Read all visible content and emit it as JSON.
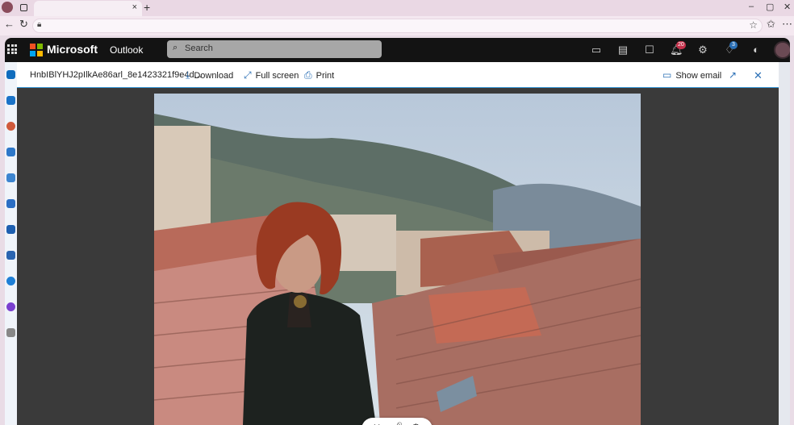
{
  "browser": {
    "close_tab_glyph": "×",
    "new_tab_glyph": "+",
    "window_controls": [
      "–",
      "▢",
      "✕"
    ],
    "nav": [
      "←",
      "↻"
    ],
    "toolbar_right": [
      "☆",
      "✩",
      "⋯"
    ]
  },
  "outlook": {
    "brand": "Microsoft",
    "app": "Outlook",
    "search_placeholder": "Search",
    "notifications_badge": "20",
    "tips_badge": "3",
    "colors": {
      "topbar": "#131313",
      "accent": "#2a6fb5",
      "badge": "#c4314b"
    }
  },
  "viewer": {
    "filename": "HnbIBlYHJ2pIlkAe86arl_8e1423321f9e4d...",
    "download": "Download",
    "fullscreen": "Full screen",
    "print": "Print",
    "show_email": "Show email"
  },
  "controls": {
    "close": "✕",
    "mic": "🎙",
    "settings": "⚙"
  }
}
